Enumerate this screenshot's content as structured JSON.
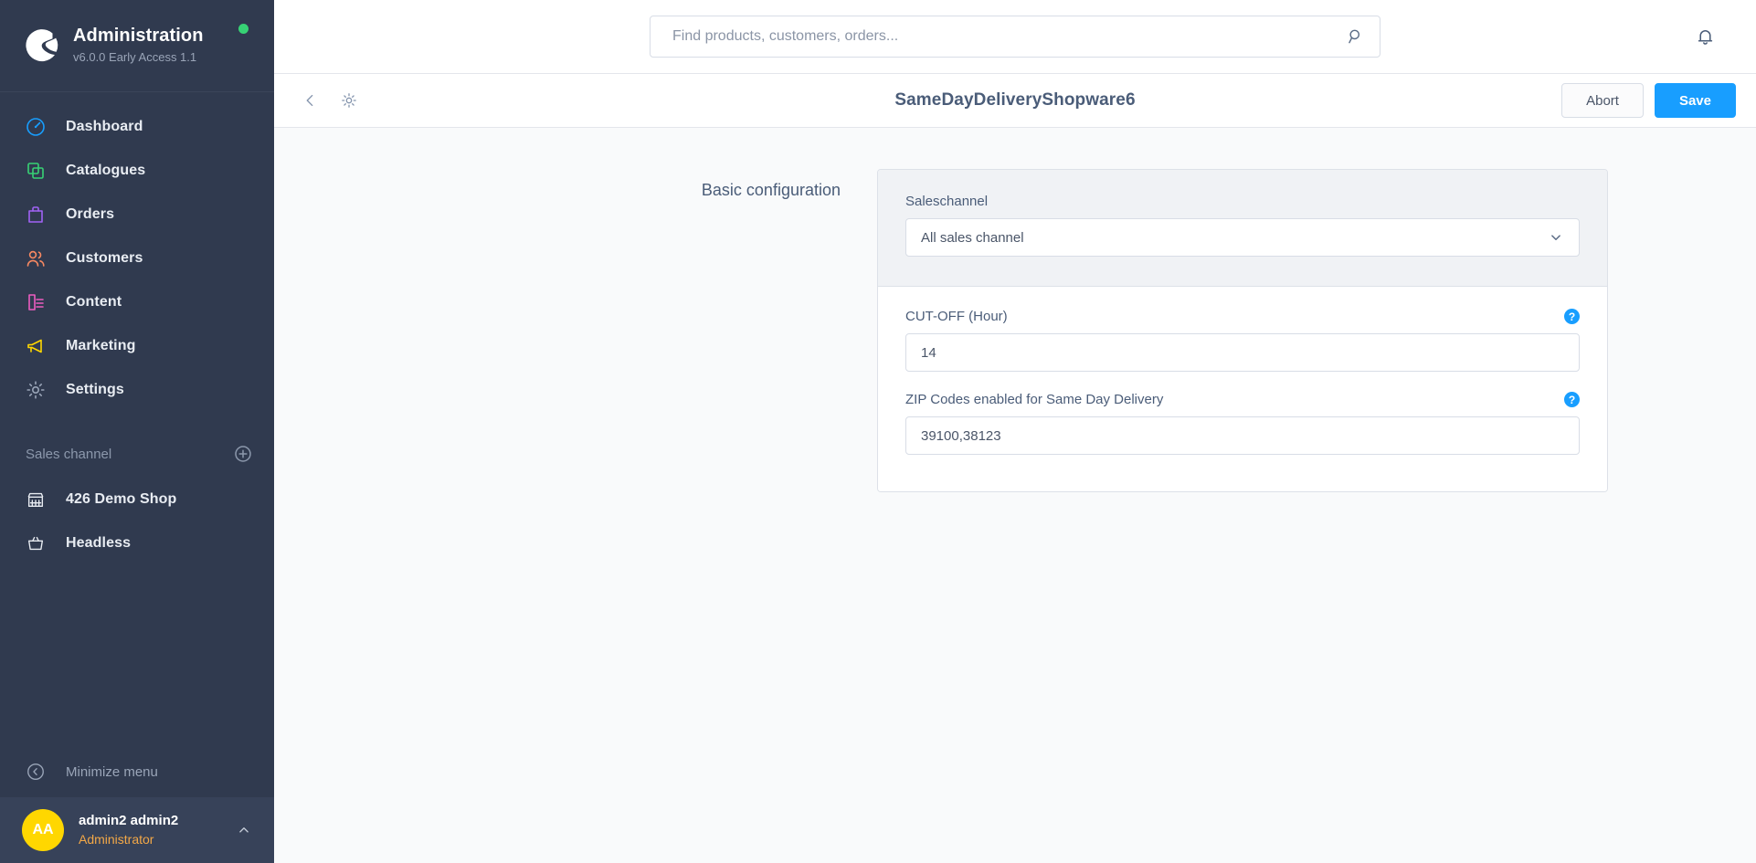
{
  "sidebar": {
    "brand": {
      "title": "Administration",
      "version": "v6.0.0 Early Access 1.1",
      "logo_icon": "shopware-logo-icon",
      "status_icon": "status-online-dot"
    },
    "items": [
      {
        "label": "Dashboard",
        "icon": "dashboard-gauge-icon",
        "color": "#189eff"
      },
      {
        "label": "Catalogues",
        "icon": "catalogues-copy-icon",
        "color": "#37d275"
      },
      {
        "label": "Orders",
        "icon": "orders-bag-icon",
        "color": "#a163f5"
      },
      {
        "label": "Customers",
        "icon": "customers-people-icon",
        "color": "#f88962"
      },
      {
        "label": "Content",
        "icon": "content-document-icon",
        "color": "#ec5cc0"
      },
      {
        "label": "Marketing",
        "icon": "marketing-megaphone-icon",
        "color": "#ffd700"
      },
      {
        "label": "Settings",
        "icon": "settings-gear-icon",
        "color": "#9aa5b8"
      }
    ],
    "sales_channel_section": {
      "label": "Sales channel",
      "add_icon": "plus-circle-icon",
      "channels": [
        {
          "label": "426 Demo Shop",
          "icon": "storefront-icon"
        },
        {
          "label": "Headless",
          "icon": "basket-icon"
        }
      ]
    },
    "minimize": {
      "label": "Minimize menu",
      "icon": "chevron-left-circle-icon"
    },
    "user": {
      "initials": "AA",
      "name": "admin2 admin2",
      "role": "Administrator",
      "caret_icon": "chevron-up-icon"
    }
  },
  "topbar": {
    "search": {
      "placeholder": "Find products, customers, orders...",
      "value": "",
      "icon": "search-icon"
    },
    "notifications_icon": "bell-icon"
  },
  "page_header": {
    "back_icon": "chevron-left-icon",
    "gear_icon": "gear-icon",
    "title": "SameDayDeliveryShopware6",
    "abort_label": "Abort",
    "save_label": "Save"
  },
  "config": {
    "section_label": "Basic configuration",
    "saleschannel": {
      "label": "Saleschannel",
      "value": "All sales channel",
      "chevron_icon": "chevron-down-icon"
    },
    "cutoff": {
      "label": "CUT-OFF (Hour)",
      "value": "14",
      "help_icon": "help-circle-icon",
      "help_glyph": "?"
    },
    "zipcodes": {
      "label": "ZIP Codes enabled for Same Day Delivery",
      "value": "39100,38123",
      "help_icon": "help-circle-icon",
      "help_glyph": "?"
    }
  },
  "colors": {
    "accent": "#189eff",
    "sidebar_bg": "#303a4f",
    "avatar_bg": "#ffd700",
    "role_text": "#f3a847",
    "status_dot": "#37d275"
  }
}
